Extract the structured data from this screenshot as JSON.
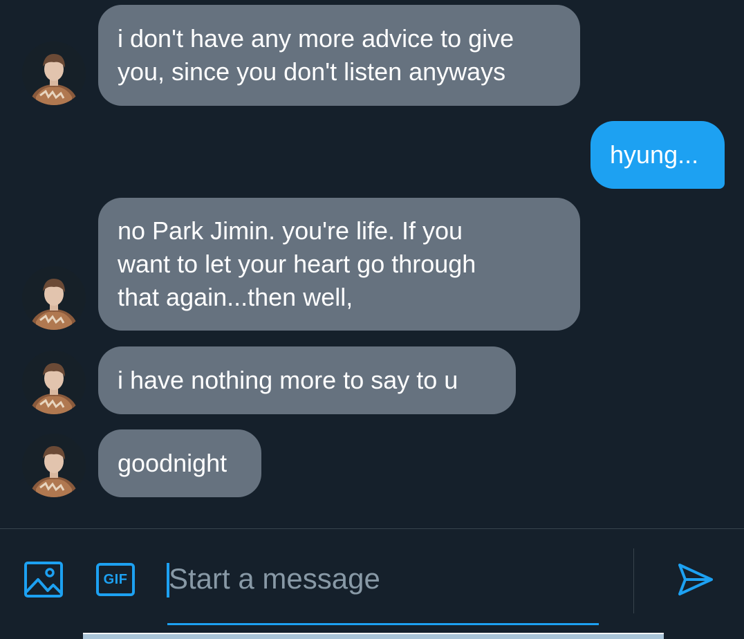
{
  "messages": [
    {
      "direction": "received",
      "text": "i don't have any more advice to give\nyou, since you don't listen anyways",
      "avatar": "avatar-photo"
    },
    {
      "direction": "sent",
      "text": "hyung..."
    },
    {
      "direction": "received",
      "text": "no Park Jimin. you're life. If you\nwant to let your heart go through\nthat again...then well,",
      "avatar": "avatar-photo"
    },
    {
      "direction": "received",
      "text": "i have nothing more to say to u",
      "avatar": "avatar-photo"
    },
    {
      "direction": "received",
      "text": "goodnight",
      "avatar": "avatar-photo"
    }
  ],
  "composer": {
    "image_icon": "image-icon",
    "gif_label": "GIF",
    "placeholder": "Start a message",
    "send_icon": "send-icon"
  },
  "colors": {
    "background": "#15202b",
    "received_bubble": "#66727f",
    "sent_bubble": "#1da1f2",
    "accent": "#1da1f2",
    "placeholder": "#8899a6"
  }
}
